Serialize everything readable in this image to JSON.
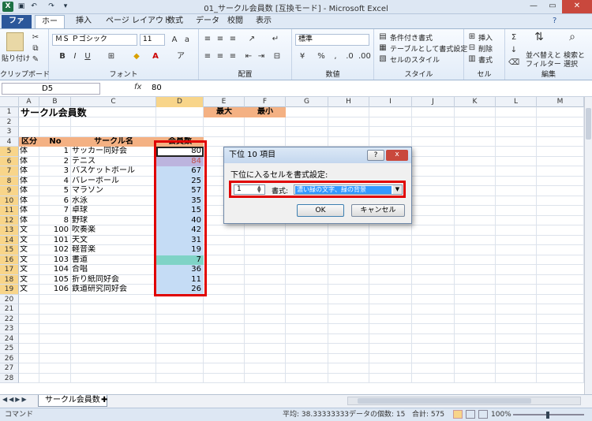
{
  "app": {
    "title": "01_サークル会員数 [互換モード] - Microsoft Excel"
  },
  "tabs": [
    "ファイル",
    "ホーム",
    "挿入",
    "ページ レイアウト",
    "数式",
    "データ",
    "校閲",
    "表示"
  ],
  "ribbon": {
    "paste_label": "貼り付け",
    "clipboard_group": "クリップボード",
    "font_name": "ＭＳ Ｐゴシック",
    "font_size": "11",
    "font_group": "フォント",
    "align_group": "配置",
    "number_format": "標準",
    "number_group": "数値",
    "cond_format": "条件付き書式",
    "table_format": "テーブルとして書式設定",
    "cell_style": "セルのスタイル",
    "style_group": "スタイル",
    "insert": "挿入",
    "delete": "削除",
    "format": "書式",
    "cells_group": "セル",
    "sort_filter": "並べ替えと",
    "sort_filter2": "フィルター",
    "find_select": "検索と",
    "find_select2": "選択",
    "edit_group": "編集"
  },
  "formula": {
    "name_box": "D5",
    "fx": "fx",
    "value": "80"
  },
  "columns": [
    "A",
    "B",
    "C",
    "D",
    "E",
    "F",
    "G",
    "H",
    "I",
    "J",
    "K",
    "L",
    "M"
  ],
  "rows": [
    "1",
    "2",
    "3",
    "4",
    "5",
    "6",
    "7",
    "8",
    "9",
    "10",
    "11",
    "12",
    "13",
    "14",
    "15",
    "16",
    "17",
    "18",
    "19",
    "20",
    "21",
    "22",
    "23",
    "24",
    "25",
    "26",
    "27",
    "28"
  ],
  "sheet": {
    "title": "サークル会員数",
    "max_label": "最大",
    "min_label": "最小",
    "header": {
      "category": "区分",
      "no": "No",
      "circle": "サークル名",
      "members": "会員数"
    },
    "records": [
      {
        "cat": "体",
        "no": "1",
        "name": "サッカー同好会",
        "val": "80"
      },
      {
        "cat": "体",
        "no": "2",
        "name": "テニス",
        "val": "84"
      },
      {
        "cat": "体",
        "no": "3",
        "name": "バスケットボール",
        "val": "67"
      },
      {
        "cat": "体",
        "no": "4",
        "name": "バレーボール",
        "val": "25"
      },
      {
        "cat": "体",
        "no": "5",
        "name": "マラソン",
        "val": "57"
      },
      {
        "cat": "体",
        "no": "6",
        "name": "水泳",
        "val": "35"
      },
      {
        "cat": "体",
        "no": "7",
        "name": "卓球",
        "val": "15"
      },
      {
        "cat": "体",
        "no": "8",
        "name": "野球",
        "val": "40"
      },
      {
        "cat": "文",
        "no": "100",
        "name": "吹奏楽",
        "val": "42"
      },
      {
        "cat": "文",
        "no": "101",
        "name": "天文",
        "val": "31"
      },
      {
        "cat": "文",
        "no": "102",
        "name": "軽音楽",
        "val": "19"
      },
      {
        "cat": "文",
        "no": "103",
        "name": "書道",
        "val": "7"
      },
      {
        "cat": "文",
        "no": "104",
        "name": "合唱",
        "val": "36"
      },
      {
        "cat": "文",
        "no": "105",
        "name": "折り紙同好会",
        "val": "11"
      },
      {
        "cat": "文",
        "no": "106",
        "name": "鉄道研究同好会",
        "val": "26"
      }
    ]
  },
  "dialog": {
    "title": "下位 10 項目",
    "prompt": "下位に入るセルを書式設定:",
    "count": "1",
    "format_label": "書式:",
    "format_value": "濃い緑の文字、緑の背景",
    "ok": "OK",
    "cancel": "キャンセル",
    "help": "?",
    "close": "x"
  },
  "sheet_tab": "サークル会員数",
  "status": {
    "mode": "コマンド",
    "average": "平均: 38.33333333",
    "count": "データの個数: 15",
    "sum": "合計: 575",
    "zoom": "100%"
  },
  "colors": {
    "accent": "#2b579a",
    "header_fill": "#f4b183",
    "red_box": "#e00000",
    "selection": "#c5dcf5"
  }
}
